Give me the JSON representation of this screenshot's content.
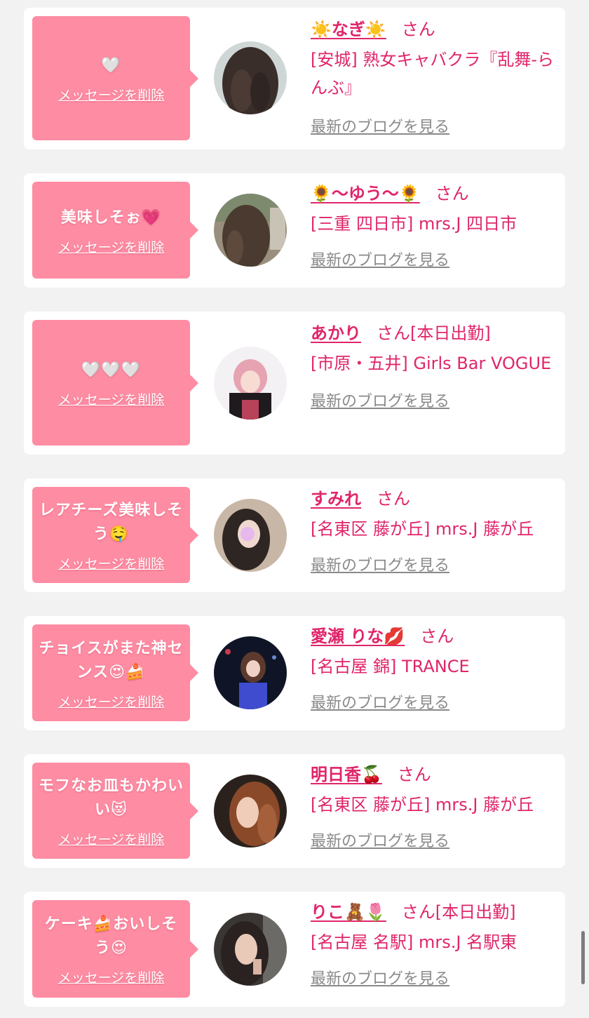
{
  "cards": [
    {
      "message": "🤍",
      "delete_label": "メッセージを削除",
      "name": "☀️なぎ☀️",
      "honorific": "さん",
      "status": "",
      "store": "[安城] 熟女キャバクラ『乱舞-らんぶ』",
      "blog_label": "最新のブログを見る"
    },
    {
      "message": "美味しそぉ💗",
      "delete_label": "メッセージを削除",
      "name": "🌻〜ゆう〜🌻",
      "honorific": "さん",
      "status": "",
      "store": "[三重 四日市] mrs.J 四日市",
      "blog_label": "最新のブログを見る"
    },
    {
      "message": "🤍🤍🤍",
      "delete_label": "メッセージを削除",
      "name": "あかり",
      "honorific": "さん",
      "status": "[本日出勤]",
      "store": "[市原・五井] Girls Bar VOGUE",
      "blog_label": "最新のブログを見る"
    },
    {
      "message": "レアチーズ美味しそう🤤",
      "delete_label": "メッセージを削除",
      "name": "すみれ",
      "honorific": "さん",
      "status": "",
      "store": "[名東区 藤が丘] mrs.J 藤が丘",
      "blog_label": "最新のブログを見る"
    },
    {
      "message": "チョイスがまた神センス😍🍰",
      "delete_label": "メッセージを削除",
      "name": "愛瀬 りな💋",
      "honorific": "さん",
      "status": "",
      "store": "[名古屋 錦] TRANCE",
      "blog_label": "最新のブログを見る"
    },
    {
      "message": "モフなお皿もかわいい😻",
      "delete_label": "メッセージを削除",
      "name": "明日香🍒",
      "honorific": "さん",
      "status": "",
      "store": "[名東区 藤が丘] mrs.J 藤が丘",
      "blog_label": "最新のブログを見る"
    },
    {
      "message": "ケーキ🍰おいしそう😍",
      "delete_label": "メッセージを削除",
      "name": "りこ🧸🌷",
      "honorific": "さん",
      "status": "[本日出勤]",
      "store": "[名古屋 名駅] mrs.J 名駅東",
      "blog_label": "最新のブログを見る"
    }
  ],
  "colors": {
    "page_background": "#f2f2f2",
    "bubble": "#fe8ca3",
    "accent_text": "#e0256a",
    "link_gray": "#8a8a8a"
  }
}
